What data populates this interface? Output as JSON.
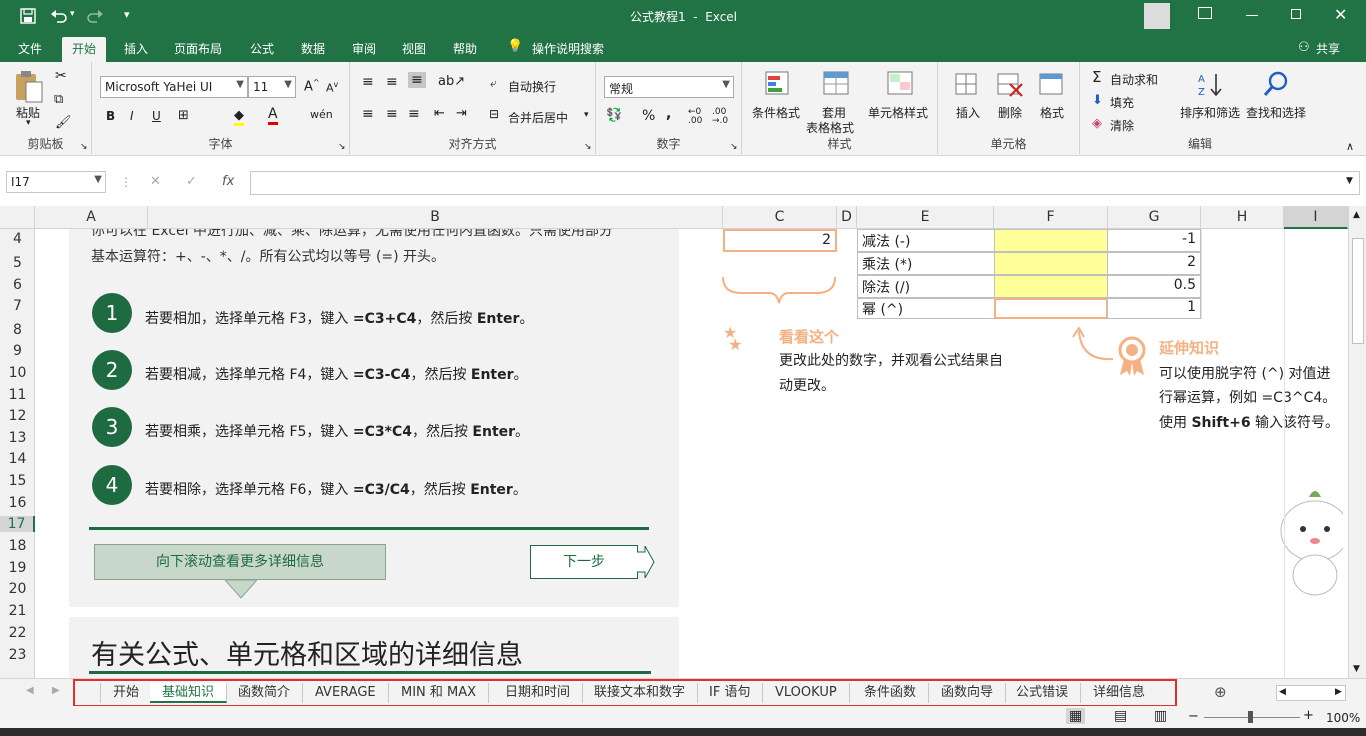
{
  "title": "公式教程1  -  Excel",
  "ribbon_tabs": [
    "文件",
    "开始",
    "插入",
    "页面布局",
    "公式",
    "数据",
    "审阅",
    "视图",
    "帮助",
    "操作说明搜索"
  ],
  "share": "共享",
  "clipboard": {
    "paste": "粘贴",
    "label": "剪贴板"
  },
  "font": {
    "name": "Microsoft YaHei UI",
    "size": "11",
    "bold": "B",
    "italic": "I",
    "underline": "U",
    "label": "字体"
  },
  "alignment": {
    "wrap": "自动换行",
    "merge": "合并后居中",
    "label": "对齐方式"
  },
  "number": {
    "format": "常规",
    "percent": "%",
    "comma": ",",
    "label": "数字"
  },
  "styles": {
    "cond": "条件格式",
    "table1": "套用",
    "table2": "表格格式",
    "cell": "单元格样式",
    "label": "样式"
  },
  "cells": {
    "insert": "插入",
    "delete": "删除",
    "format": "格式",
    "label": "单元格"
  },
  "editing": {
    "autosum": "自动求和",
    "fill": "填充",
    "clear": "清除",
    "sort": "排序和筛选",
    "find": "查找和选择",
    "label": "编辑"
  },
  "namebox": "I17",
  "fx": "fx",
  "columns": [
    "A",
    "B",
    "C",
    "D",
    "E",
    "F",
    "G",
    "H",
    "I"
  ],
  "rows": [
    "4",
    "5",
    "6",
    "7",
    "8",
    "9",
    "10",
    "11",
    "12",
    "13",
    "14",
    "15",
    "16",
    "17",
    "18",
    "19",
    "20",
    "21",
    "22",
    "23"
  ],
  "intro_line1": "你可以在 Excel 中进行加、减、乘、除运算，无需使用任何内置函数。只需使用部分",
  "intro_line2": "基本运算符：+、-、*、/。所有公式均以等号 (=) 开头。",
  "steps": [
    {
      "num": "1",
      "pre": "若要相加，选择单元格 F3，键入 ",
      "code": "=C3+C4",
      "post": "，然后按 ",
      "key": "Enter",
      "end": "。"
    },
    {
      "num": "2",
      "pre": "若要相减，选择单元格 F4，键入 ",
      "code": "=C3-C4",
      "post": "，然后按 ",
      "key": "Enter",
      "end": "。"
    },
    {
      "num": "3",
      "pre": "若要相乘，选择单元格 F5，键入 ",
      "code": "=C3*C4",
      "post": "，然后按 ",
      "key": "Enter",
      "end": "。"
    },
    {
      "num": "4",
      "pre": "若要相除，选择单元格 F6，键入 ",
      "code": "=C3/C4",
      "post": "，然后按 ",
      "key": "Enter",
      "end": "。"
    }
  ],
  "scroll_btn": "向下滚动查看更多详细信息",
  "next_btn": "下一步",
  "heading": "有关公式、单元格和区域的详细信息",
  "c4_value": "2",
  "ops": [
    {
      "name": "减法 (-)",
      "result": "-1"
    },
    {
      "name": "乘法 (*)",
      "result": "2"
    },
    {
      "name": "除法 (/)",
      "result": "0.5"
    },
    {
      "name": "幂 (^)",
      "result": "1"
    }
  ],
  "look_title": "看看这个",
  "look_text1": "更改此处的数字，并观看公式结果自",
  "look_text2": "动更改。",
  "ext_title": "延伸知识",
  "ext_text1": "可以使用脱字符 (^) 对值进",
  "ext_text2": "行幂运算，例如 =C3^C4。",
  "ext_text3_pre": "使用 ",
  "ext_text3_key": "Shift+6",
  "ext_text3_post": " 输入该符号。",
  "sheet_tabs": [
    "开始",
    "基础知识",
    "函数简介",
    "AVERAGE",
    "MIN 和 MAX",
    "日期和时间",
    "联接文本和数字",
    "IF 语句",
    "VLOOKUP",
    "条件函数",
    "函数向导",
    "公式错误",
    "详细信息"
  ],
  "zoom": "100%",
  "colors": {
    "accent": "#217346",
    "step": "#1e6b41",
    "orange": "#f4b183",
    "yellow": "#ffff99",
    "highlight": "#e03030"
  }
}
